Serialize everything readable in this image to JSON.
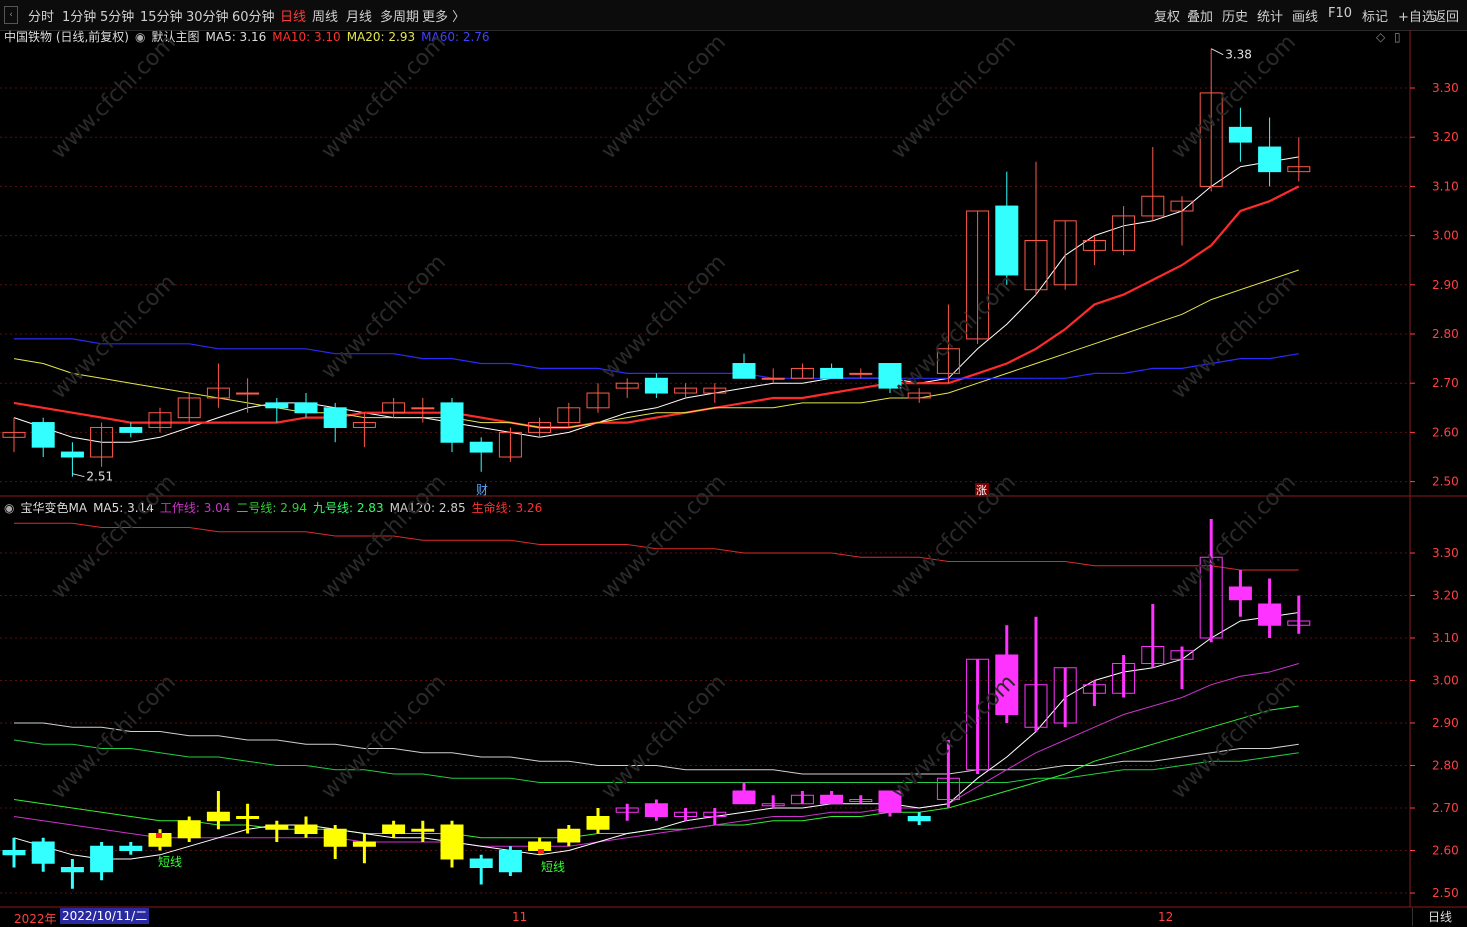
{
  "toolbar": {
    "periods": [
      "分时",
      "1分钟",
      "5分钟",
      "15分钟",
      "30分钟",
      "60分钟",
      "日线",
      "周线",
      "月线",
      "多周期",
      "更多 〉"
    ],
    "active_period": "日线",
    "right_buttons": [
      "复权",
      "叠加",
      "历史",
      "统计",
      "画线",
      "F10",
      "标记",
      "+自选",
      "返回"
    ]
  },
  "main_legend": {
    "stock": "中国铁物 (日线,前复权)",
    "template": "默认主图",
    "ma5": "MA5: 3.16",
    "ma10": "MA10: 3.10",
    "ma20": "MA20: 2.93",
    "ma60": "MA60: 2.76"
  },
  "sub_legend": {
    "name": "宝华变色MA",
    "ma5": "MA5: 3.14",
    "work": "工作线: 3.04",
    "second": "二号线: 2.94",
    "ninth": "九号线: 2.83",
    "ma120": "MA120: 2.85",
    "life": "生命线: 3.26"
  },
  "main_axis": [
    "3.30",
    "3.20",
    "3.10",
    "3.00",
    "2.90",
    "2.80",
    "2.70",
    "2.60",
    "2.50"
  ],
  "sub_axis": [
    "3.30",
    "3.20",
    "3.10",
    "3.00",
    "2.90",
    "2.80",
    "2.70",
    "2.60",
    "2.50"
  ],
  "annotations": {
    "high": "3.38",
    "low": "2.51",
    "finance_mark": "财",
    "rise_mark": "涨",
    "short_line_1": "短线",
    "short_line_2": "短线"
  },
  "time_axis": {
    "year": "2022年",
    "cursor_date": "2022/10/11/二",
    "m11": "11",
    "m12": "12",
    "period": "日线"
  },
  "colors": {
    "up": "#ff5a4a",
    "down": "#33ffff",
    "ma5": "#ffffff",
    "ma10": "#ff2a2a",
    "ma20": "#e6e64a",
    "ma60": "#2a2aff",
    "yellow_candle": "#ffff00",
    "magenta": "#ff33ff",
    "work_line": "#cc33cc",
    "second_line": "#33cc33",
    "life_line": "#dd2a2a"
  },
  "chart_data": {
    "type": "candlestick",
    "title": "中国铁物 (日线,前复权)",
    "ylim": [
      2.47,
      3.42
    ],
    "candles": [
      {
        "o": 2.59,
        "h": 2.63,
        "l": 2.56,
        "c": 2.6
      },
      {
        "o": 2.62,
        "h": 2.63,
        "l": 2.55,
        "c": 2.57
      },
      {
        "o": 2.56,
        "h": 2.58,
        "l": 2.51,
        "c": 2.55
      },
      {
        "o": 2.55,
        "h": 2.62,
        "l": 2.53,
        "c": 2.61
      },
      {
        "o": 2.61,
        "h": 2.62,
        "l": 2.59,
        "c": 2.6
      },
      {
        "o": 2.61,
        "h": 2.65,
        "l": 2.6,
        "c": 2.64
      },
      {
        "o": 2.63,
        "h": 2.68,
        "l": 2.62,
        "c": 2.67
      },
      {
        "o": 2.67,
        "h": 2.74,
        "l": 2.65,
        "c": 2.69
      },
      {
        "o": 2.68,
        "h": 2.71,
        "l": 2.64,
        "c": 2.68
      },
      {
        "o": 2.66,
        "h": 2.67,
        "l": 2.62,
        "c": 2.65
      },
      {
        "o": 2.66,
        "h": 2.68,
        "l": 2.63,
        "c": 2.64
      },
      {
        "o": 2.65,
        "h": 2.66,
        "l": 2.58,
        "c": 2.61
      },
      {
        "o": 2.61,
        "h": 2.64,
        "l": 2.57,
        "c": 2.62
      },
      {
        "o": 2.64,
        "h": 2.67,
        "l": 2.63,
        "c": 2.66
      },
      {
        "o": 2.65,
        "h": 2.67,
        "l": 2.62,
        "c": 2.65
      },
      {
        "o": 2.66,
        "h": 2.67,
        "l": 2.56,
        "c": 2.58
      },
      {
        "o": 2.58,
        "h": 2.59,
        "l": 2.52,
        "c": 2.56
      },
      {
        "o": 2.55,
        "h": 2.61,
        "l": 2.54,
        "c": 2.6
      },
      {
        "o": 2.6,
        "h": 2.63,
        "l": 2.59,
        "c": 2.62
      },
      {
        "o": 2.62,
        "h": 2.66,
        "l": 2.61,
        "c": 2.65
      },
      {
        "o": 2.65,
        "h": 2.7,
        "l": 2.64,
        "c": 2.68
      },
      {
        "o": 2.69,
        "h": 2.71,
        "l": 2.67,
        "c": 2.7
      },
      {
        "o": 2.71,
        "h": 2.72,
        "l": 2.67,
        "c": 2.68
      },
      {
        "o": 2.68,
        "h": 2.7,
        "l": 2.67,
        "c": 2.69
      },
      {
        "o": 2.68,
        "h": 2.7,
        "l": 2.66,
        "c": 2.69
      },
      {
        "o": 2.74,
        "h": 2.76,
        "l": 2.71,
        "c": 2.71
      },
      {
        "o": 2.71,
        "h": 2.73,
        "l": 2.7,
        "c": 2.71
      },
      {
        "o": 2.71,
        "h": 2.74,
        "l": 2.71,
        "c": 2.73
      },
      {
        "o": 2.73,
        "h": 2.74,
        "l": 2.71,
        "c": 2.71
      },
      {
        "o": 2.72,
        "h": 2.73,
        "l": 2.71,
        "c": 2.72
      },
      {
        "o": 2.74,
        "h": 2.74,
        "l": 2.68,
        "c": 2.69
      },
      {
        "o": 2.67,
        "h": 2.69,
        "l": 2.66,
        "c": 2.68
      },
      {
        "o": 2.72,
        "h": 2.86,
        "l": 2.7,
        "c": 2.77
      },
      {
        "o": 2.79,
        "h": 3.05,
        "l": 2.78,
        "c": 3.05
      },
      {
        "o": 3.06,
        "h": 3.13,
        "l": 2.9,
        "c": 2.92
      },
      {
        "o": 2.89,
        "h": 3.15,
        "l": 2.88,
        "c": 2.99
      },
      {
        "o": 2.9,
        "h": 3.03,
        "l": 2.89,
        "c": 3.03
      },
      {
        "o": 2.97,
        "h": 3.0,
        "l": 2.94,
        "c": 2.99
      },
      {
        "o": 2.97,
        "h": 3.06,
        "l": 2.96,
        "c": 3.04
      },
      {
        "o": 3.04,
        "h": 3.18,
        "l": 3.03,
        "c": 3.08
      },
      {
        "o": 3.05,
        "h": 3.08,
        "l": 2.98,
        "c": 3.07
      },
      {
        "o": 3.1,
        "h": 3.38,
        "l": 3.09,
        "c": 3.29
      },
      {
        "o": 3.22,
        "h": 3.26,
        "l": 3.15,
        "c": 3.19
      },
      {
        "o": 3.18,
        "h": 3.24,
        "l": 3.1,
        "c": 3.13
      },
      {
        "o": 3.13,
        "h": 3.2,
        "l": 3.11,
        "c": 3.14
      }
    ],
    "ma": [
      {
        "name": "MA5",
        "values": [
          2.63,
          2.61,
          2.59,
          2.58,
          2.58,
          2.59,
          2.61,
          2.63,
          2.65,
          2.66,
          2.66,
          2.65,
          2.64,
          2.63,
          2.63,
          2.62,
          2.61,
          2.6,
          2.59,
          2.6,
          2.62,
          2.64,
          2.65,
          2.67,
          2.68,
          2.69,
          2.7,
          2.7,
          2.71,
          2.71,
          2.71,
          2.7,
          2.71,
          2.77,
          2.82,
          2.88,
          2.96,
          3.0,
          3.02,
          3.03,
          3.05,
          3.1,
          3.14,
          3.15,
          3.16
        ]
      },
      {
        "name": "MA10",
        "values": [
          2.66,
          2.65,
          2.64,
          2.63,
          2.62,
          2.62,
          2.62,
          2.62,
          2.62,
          2.62,
          2.63,
          2.63,
          2.64,
          2.64,
          2.64,
          2.64,
          2.63,
          2.62,
          2.61,
          2.61,
          2.62,
          2.62,
          2.63,
          2.64,
          2.65,
          2.66,
          2.67,
          2.67,
          2.68,
          2.69,
          2.7,
          2.7,
          2.7,
          2.72,
          2.74,
          2.77,
          2.81,
          2.86,
          2.88,
          2.91,
          2.94,
          2.98,
          3.05,
          3.07,
          3.1
        ]
      },
      {
        "name": "MA20",
        "values": [
          2.75,
          2.74,
          2.72,
          2.71,
          2.7,
          2.69,
          2.68,
          2.67,
          2.66,
          2.65,
          2.64,
          2.64,
          2.63,
          2.63,
          2.63,
          2.63,
          2.62,
          2.62,
          2.61,
          2.61,
          2.62,
          2.63,
          2.64,
          2.64,
          2.65,
          2.65,
          2.65,
          2.66,
          2.66,
          2.66,
          2.67,
          2.67,
          2.68,
          2.7,
          2.72,
          2.74,
          2.76,
          2.78,
          2.8,
          2.82,
          2.84,
          2.87,
          2.89,
          2.91,
          2.93
        ]
      },
      {
        "name": "MA60",
        "values": [
          2.79,
          2.79,
          2.79,
          2.78,
          2.78,
          2.78,
          2.78,
          2.77,
          2.77,
          2.77,
          2.77,
          2.76,
          2.76,
          2.76,
          2.75,
          2.75,
          2.74,
          2.74,
          2.73,
          2.73,
          2.73,
          2.72,
          2.72,
          2.72,
          2.72,
          2.72,
          2.71,
          2.71,
          2.71,
          2.71,
          2.71,
          2.71,
          2.71,
          2.71,
          2.71,
          2.71,
          2.71,
          2.72,
          2.72,
          2.73,
          2.73,
          2.74,
          2.75,
          2.75,
          2.76
        ]
      }
    ],
    "sub": {
      "lines": [
        {
          "name": "生命线",
          "values": [
            3.37,
            3.37,
            3.37,
            3.36,
            3.36,
            3.36,
            3.36,
            3.35,
            3.35,
            3.35,
            3.35,
            3.34,
            3.34,
            3.34,
            3.33,
            3.33,
            3.33,
            3.33,
            3.32,
            3.32,
            3.32,
            3.32,
            3.31,
            3.31,
            3.31,
            3.3,
            3.3,
            3.3,
            3.3,
            3.29,
            3.29,
            3.29,
            3.28,
            3.28,
            3.28,
            3.28,
            3.28,
            3.27,
            3.27,
            3.27,
            3.27,
            3.27,
            3.26,
            3.26,
            3.26
          ]
        },
        {
          "name": "MA120",
          "values": [
            2.9,
            2.9,
            2.89,
            2.89,
            2.88,
            2.88,
            2.87,
            2.87,
            2.86,
            2.86,
            2.85,
            2.85,
            2.84,
            2.84,
            2.83,
            2.83,
            2.82,
            2.82,
            2.81,
            2.81,
            2.8,
            2.8,
            2.8,
            2.79,
            2.79,
            2.79,
            2.79,
            2.78,
            2.78,
            2.78,
            2.78,
            2.78,
            2.78,
            2.79,
            2.79,
            2.79,
            2.8,
            2.8,
            2.81,
            2.81,
            2.82,
            2.83,
            2.84,
            2.84,
            2.85
          ]
        },
        {
          "name": "九号线",
          "values": [
            2.86,
            2.85,
            2.85,
            2.84,
            2.84,
            2.83,
            2.82,
            2.82,
            2.81,
            2.8,
            2.8,
            2.79,
            2.79,
            2.78,
            2.78,
            2.77,
            2.77,
            2.77,
            2.76,
            2.76,
            2.76,
            2.76,
            2.76,
            2.76,
            2.76,
            2.76,
            2.76,
            2.76,
            2.76,
            2.76,
            2.76,
            2.76,
            2.76,
            2.76,
            2.76,
            2.77,
            2.77,
            2.78,
            2.79,
            2.79,
            2.8,
            2.81,
            2.81,
            2.82,
            2.83
          ]
        },
        {
          "name": "二号线",
          "values": [
            2.72,
            2.71,
            2.7,
            2.69,
            2.68,
            2.67,
            2.67,
            2.66,
            2.66,
            2.65,
            2.65,
            2.65,
            2.64,
            2.64,
            2.64,
            2.64,
            2.63,
            2.63,
            2.63,
            2.63,
            2.64,
            2.64,
            2.65,
            2.65,
            2.66,
            2.66,
            2.67,
            2.67,
            2.68,
            2.68,
            2.69,
            2.69,
            2.7,
            2.72,
            2.74,
            2.76,
            2.78,
            2.81,
            2.83,
            2.85,
            2.87,
            2.89,
            2.91,
            2.93,
            2.94
          ]
        },
        {
          "name": "工作线",
          "values": [
            2.68,
            2.67,
            2.66,
            2.65,
            2.64,
            2.63,
            2.63,
            2.63,
            2.63,
            2.63,
            2.63,
            2.63,
            2.62,
            2.62,
            2.62,
            2.62,
            2.61,
            2.61,
            2.61,
            2.61,
            2.62,
            2.63,
            2.64,
            2.65,
            2.66,
            2.67,
            2.68,
            2.68,
            2.69,
            2.69,
            2.7,
            2.7,
            2.71,
            2.75,
            2.79,
            2.83,
            2.86,
            2.89,
            2.92,
            2.94,
            2.96,
            2.99,
            3.01,
            3.02,
            3.04
          ]
        }
      ]
    }
  }
}
